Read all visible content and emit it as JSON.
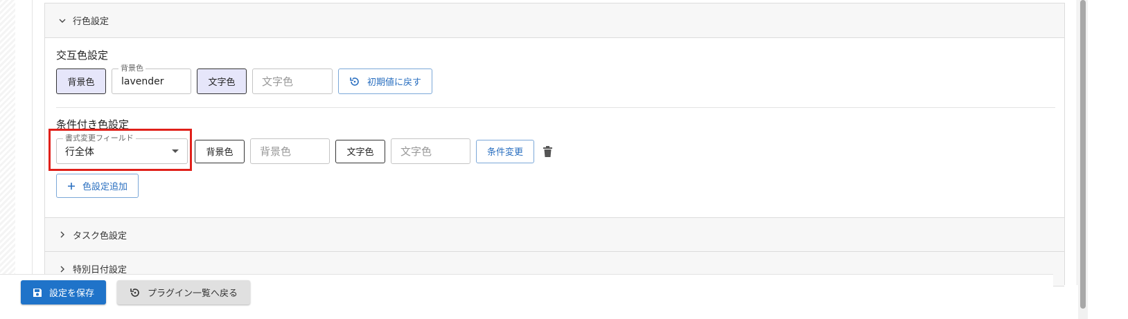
{
  "sections": {
    "row_color": {
      "header": "行色設定",
      "alternate": {
        "title": "交互色設定",
        "bg_button": "背景色",
        "bg_field_label": "背景色",
        "bg_field_value": "lavender",
        "text_button": "文字色",
        "text_field_placeholder": "文字色",
        "reset_button": "初期値に戻す"
      },
      "conditional": {
        "title": "条件付き色設定",
        "format_field_label": "書式変更フィールド",
        "format_field_value": "行全体",
        "bg_button": "背景色",
        "bg_field_placeholder": "背景色",
        "text_button": "文字色",
        "text_field_placeholder": "文字色",
        "condition_button": "条件変更",
        "add_button": "色設定追加"
      }
    },
    "task_color": {
      "header": "タスク色設定"
    },
    "special_date": {
      "header": "特別日付設定"
    }
  },
  "footer": {
    "save_label": "設定を保存",
    "back_label": "プラグイン一覧へ戻る"
  },
  "colors": {
    "primary": "#1f73c9",
    "highlight": "#e0201a",
    "lavender": "#e6e6fa"
  },
  "icons": [
    "chevron-down-icon",
    "chevron-right-icon",
    "restore-icon",
    "plus-icon",
    "trash-icon",
    "save-icon"
  ]
}
